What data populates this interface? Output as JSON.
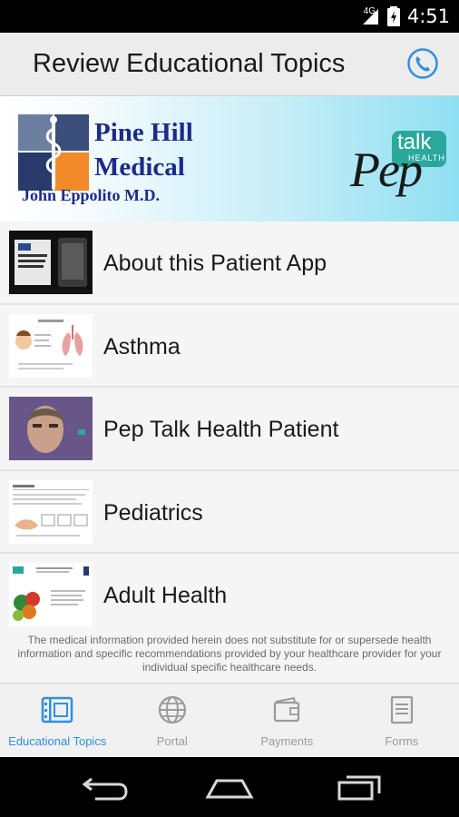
{
  "status_bar": {
    "network": "4G",
    "time": "4:51"
  },
  "app_bar": {
    "title": "Review Educational Topics",
    "call_icon": "phone-icon"
  },
  "banner": {
    "practice_line1": "Pine Hill",
    "practice_line2": "Medical",
    "doctor": "John Eppolito M.D.",
    "partner_script": "Pep",
    "partner_bubble": "talk",
    "partner_tag": "HEALTH"
  },
  "topics": [
    {
      "label": "About this Patient App",
      "thumb": "video-screen-thumbnail"
    },
    {
      "label": "Asthma",
      "thumb": "lungs-slide-thumbnail"
    },
    {
      "label": "Pep Talk Health Patient",
      "thumb": "person-video-thumbnail"
    },
    {
      "label": "Pediatrics",
      "thumb": "pediatrics-slide-thumbnail"
    },
    {
      "label": "Adult Health",
      "thumb": "fruit-slide-thumbnail"
    }
  ],
  "disclaimer": "The medical information provided herein does not substitute for or supersede health information and specific recommendations provided by your healthcare provider for your individual specific healthcare needs.",
  "bottom_nav": [
    {
      "label": "Educational Topics",
      "icon": "film-icon",
      "active": true
    },
    {
      "label": "Portal",
      "icon": "globe-icon",
      "active": false
    },
    {
      "label": "Payments",
      "icon": "wallet-icon",
      "active": false
    },
    {
      "label": "Forms",
      "icon": "document-icon",
      "active": false
    }
  ],
  "colors": {
    "accent": "#2f8fe0",
    "logo_navy": "#1c2a8a",
    "pep_teal": "#2aa89c"
  }
}
